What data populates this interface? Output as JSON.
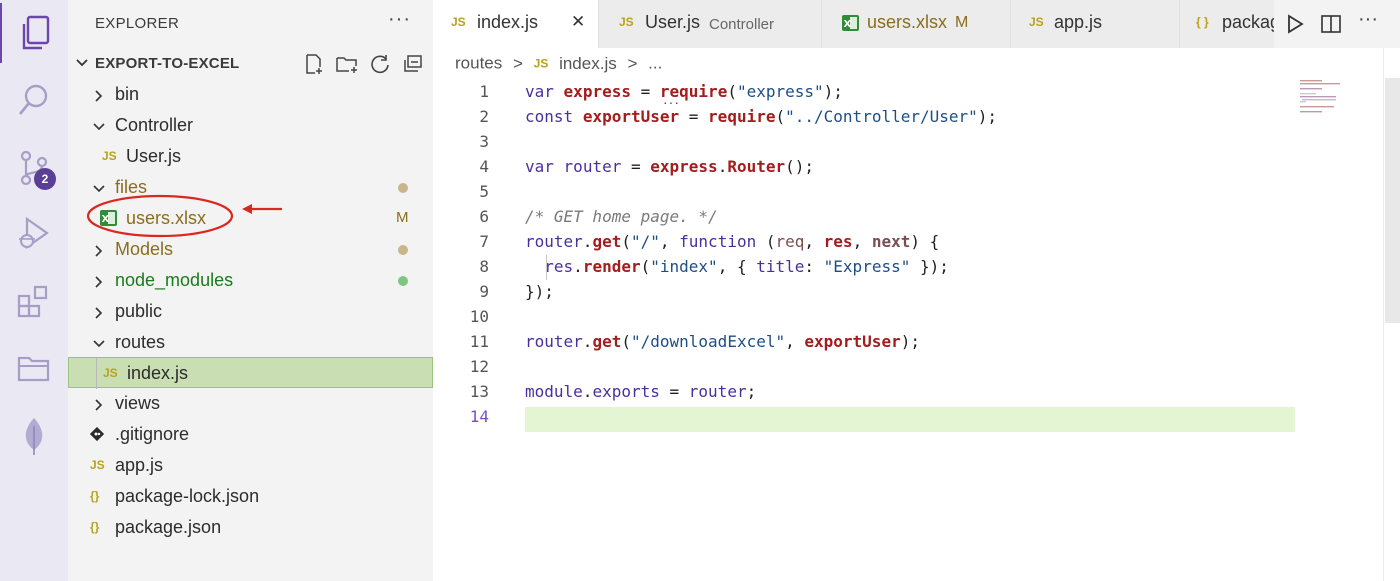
{
  "activity_bar": {
    "items": [
      {
        "icon": "explorer-icon"
      },
      {
        "icon": "search-icon"
      },
      {
        "icon": "source-control-icon",
        "badge": "2"
      },
      {
        "icon": "run-debug-icon"
      },
      {
        "icon": "extensions-icon"
      },
      {
        "icon": "folder-icon"
      },
      {
        "icon": "leaf-icon"
      }
    ]
  },
  "sidebar": {
    "title": "EXPLORER",
    "more": "···",
    "project": "EXPORT-TO-EXCEL",
    "tree": [
      {
        "label": "bin",
        "type": "folder",
        "expanded": false
      },
      {
        "label": "Controller",
        "type": "folder",
        "expanded": true
      },
      {
        "label": "User.js",
        "type": "js"
      },
      {
        "label": "files",
        "type": "folder",
        "expanded": true
      },
      {
        "label": "users.xlsx",
        "type": "xlsx",
        "status": "M"
      },
      {
        "label": "Models",
        "type": "folder",
        "expanded": false
      },
      {
        "label": "node_modules",
        "type": "folder",
        "expanded": false
      },
      {
        "label": "public",
        "type": "folder",
        "expanded": false
      },
      {
        "label": "routes",
        "type": "folder",
        "expanded": true
      },
      {
        "label": "index.js",
        "type": "js"
      },
      {
        "label": "views",
        "type": "folder",
        "expanded": false
      },
      {
        "label": ".gitignore",
        "type": "git"
      },
      {
        "label": "app.js",
        "type": "js"
      },
      {
        "label": "package-lock.json",
        "type": "json"
      },
      {
        "label": "package.json",
        "type": "json"
      }
    ]
  },
  "tabs": [
    {
      "icon": "JS",
      "label": "index.js",
      "close": "✕"
    },
    {
      "icon": "JS",
      "label": "User.js",
      "desc": "Controller"
    },
    {
      "icon": "xlsx",
      "label": "users.xlsx",
      "status": "M"
    },
    {
      "icon": "JS",
      "label": "app.js"
    },
    {
      "icon": "{ }",
      "label": "packag"
    }
  ],
  "breadcrumb": {
    "folder": "routes",
    "sep": ">",
    "icon": "JS",
    "file": "index.js",
    "tail": "..."
  },
  "code": {
    "line_numbers": [
      "1",
      "2",
      "3",
      "4",
      "5",
      "6",
      "7",
      "8",
      "9",
      "10",
      "11",
      "12",
      "13",
      "14"
    ],
    "current_line": "14"
  },
  "colors": {
    "activity_bg": "#eae8f3",
    "sidebar_bg": "#f3f3f3",
    "selection": "#c9dfb3",
    "highlight_line": "#e3f5d3",
    "annotation": "#d9281f",
    "modified": "#8a6d1e",
    "untracked_green": "#1b7a1b"
  }
}
